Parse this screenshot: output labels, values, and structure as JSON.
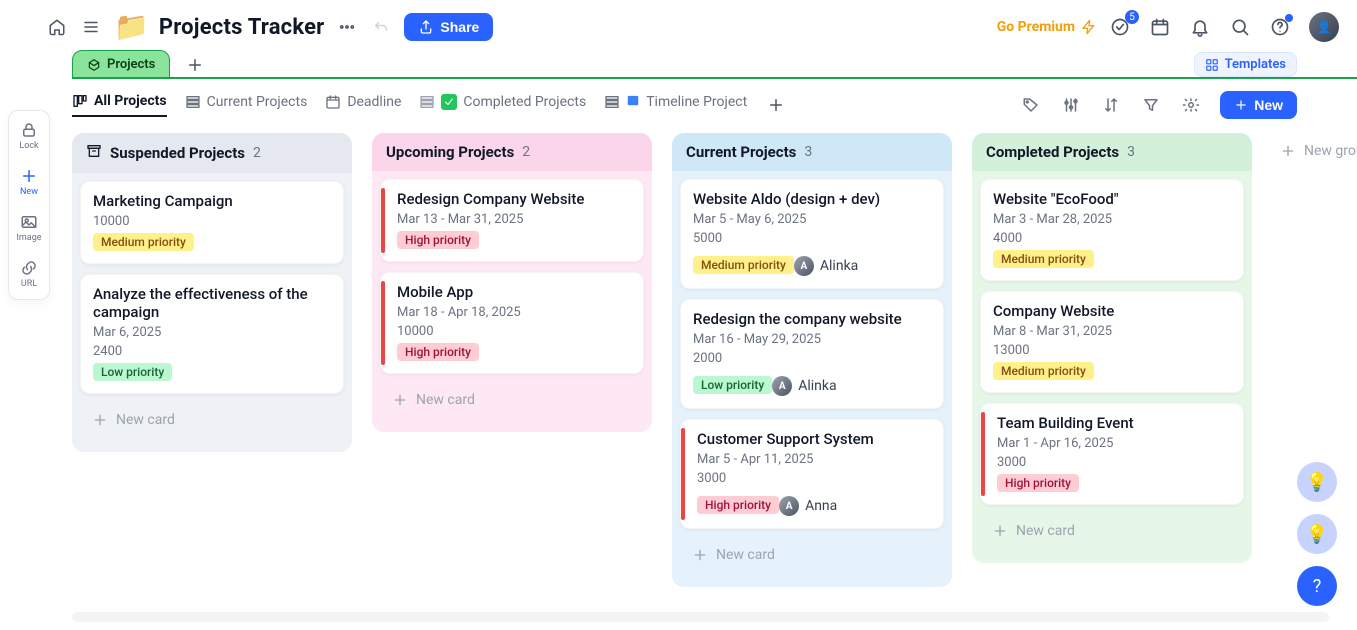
{
  "header": {
    "title": "Projects Tracker",
    "share": "Share",
    "go_premium": "Go Premium",
    "templates": "Templates",
    "notif_count": "5"
  },
  "left_rail": {
    "lock": "Lock",
    "new": "New",
    "image": "Image",
    "url": "URL"
  },
  "page_tabs": {
    "projects": "Projects"
  },
  "views": {
    "all": "All Projects",
    "current": "Current Projects",
    "deadline": "Deadline",
    "completed": "Completed Projects",
    "timeline": "Timeline Project",
    "new": "New"
  },
  "board": {
    "new_card": "New card",
    "new_group": "New grou",
    "columns": [
      {
        "name": "Suspended Projects",
        "count": "2",
        "cards": [
          {
            "title": "Marketing Campaign",
            "lines": [
              "10000"
            ],
            "priority": "Medium priority",
            "priority_class": "pri-medium"
          },
          {
            "title": "Analyze the effectiveness of the campaign",
            "lines": [
              "Mar 6, 2025",
              "2400"
            ],
            "priority": "Low priority",
            "priority_class": "pri-low"
          }
        ]
      },
      {
        "name": "Upcoming Projects",
        "count": "2",
        "cards": [
          {
            "title": "Redesign Company Website",
            "lines": [
              "Mar 13 - Mar 31, 2025"
            ],
            "priority": "High priority",
            "priority_class": "pri-high",
            "stripe": "#ef4444"
          },
          {
            "title": "Mobile App",
            "lines": [
              "Mar 18 - Apr 18, 2025",
              "10000"
            ],
            "priority": "High priority",
            "priority_class": "pri-high",
            "stripe": "#ef4444"
          }
        ]
      },
      {
        "name": "Current Projects",
        "count": "3",
        "cards": [
          {
            "title": "Website Aldo (design + dev)",
            "lines": [
              "Mar 5 - May 6, 2025",
              "5000"
            ],
            "priority": "Medium priority",
            "priority_class": "pri-medium",
            "assignee": "Alinka"
          },
          {
            "title": "Redesign the company website",
            "lines": [
              "Mar 16 - May 29, 2025",
              "2000"
            ],
            "priority": "Low priority",
            "priority_class": "pri-low",
            "assignee": "Alinka"
          },
          {
            "title": "Customer Support System",
            "lines": [
              "Mar 5 - Apr 11, 2025",
              "3000"
            ],
            "priority": "High priority",
            "priority_class": "pri-high",
            "assignee": "Anna",
            "stripe": "#ef4444"
          }
        ]
      },
      {
        "name": "Completed Projects",
        "count": "3",
        "cards": [
          {
            "title": "Website \"EcoFood\"",
            "lines": [
              "Mar 3 - Mar 28, 2025",
              "4000"
            ],
            "priority": "Medium priority",
            "priority_class": "pri-medium"
          },
          {
            "title": " Company Website",
            "lines": [
              "Mar 8 - Mar 31, 2025",
              "13000"
            ],
            "priority": "Medium priority",
            "priority_class": "pri-medium"
          },
          {
            "title": "Team Building Event",
            "lines": [
              "Mar 1 - Apr 16, 2025",
              "3000"
            ],
            "priority": "High priority",
            "priority_class": "pri-high",
            "stripe": "#ef4444"
          }
        ]
      }
    ]
  }
}
